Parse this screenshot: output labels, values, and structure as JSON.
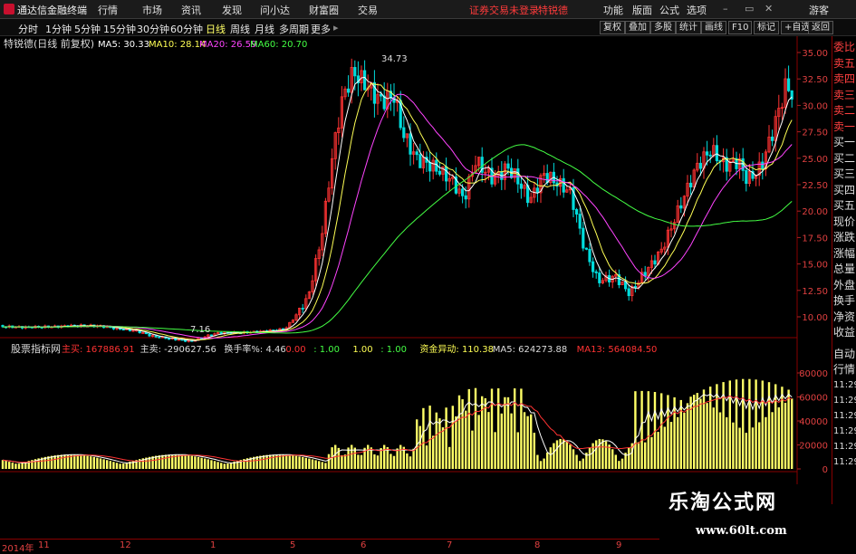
{
  "app": {
    "title": "通达信金融终端",
    "menu": [
      "行情",
      "市场",
      "资讯",
      "发现",
      "问小达",
      "财富圈",
      "交易"
    ],
    "login_status": "证券交易未登录",
    "stock_name": "特锐德",
    "right_menu": [
      "功能",
      "版面",
      "公式",
      "选项"
    ],
    "guest": "游客",
    "logo_icon": "app-logo-icon"
  },
  "toolbar": {
    "periods": [
      "分时",
      "1分钟",
      "5分钟",
      "15分钟",
      "30分钟",
      "60分钟",
      "日线",
      "周线",
      "月线",
      "多周期",
      "更多"
    ],
    "active_period": "日线",
    "right_buttons": [
      "复权",
      "叠加",
      "多股",
      "统计",
      "画线",
      "F10",
      "标记",
      "+自选",
      "返回"
    ]
  },
  "main_chart": {
    "header_title": "特锐德(日线 前复权)",
    "ma_labels": [
      {
        "text": "MA5: 30.33",
        "color": "#ffffff"
      },
      {
        "text": "MA10: 28.14",
        "color": "#ffff55"
      },
      {
        "text": "MA20: 26.59",
        "color": "#ff44ff"
      },
      {
        "text": "MA60: 20.70",
        "color": "#44ff44"
      }
    ],
    "price_axis": [
      "35.00",
      "32.50",
      "30.00",
      "27.50",
      "25.00",
      "22.50",
      "20.00",
      "17.50",
      "15.00",
      "12.50",
      "10.00"
    ],
    "high_label": "34.73",
    "low_label": "7.16",
    "up_color": "#ff3333",
    "down_color": "#00dddd"
  },
  "sub_chart": {
    "indicator_title": "股票指标网",
    "fields": [
      {
        "text": "主买: 167886.91",
        "color": "#ff3333"
      },
      {
        "text": "主卖: -290627.56",
        "color": "#dddddd"
      },
      {
        "text": "换手率%: 4.46",
        "color": "#dddddd"
      },
      {
        "text": "0.00",
        "color": "#ff3333"
      },
      {
        "text": ": 1.00",
        "color": "#44ff44"
      },
      {
        "text": "1.00",
        "color": "#ffff55"
      },
      {
        "text": ": 1.00",
        "color": "#44ff44"
      },
      {
        "text": "资金异动: 110.38",
        "color": "#ffff55"
      },
      {
        "text": "MA5: 624273.88",
        "color": "#dddddd"
      },
      {
        "text": "MA13: 564084.50",
        "color": "#ff3333"
      }
    ],
    "axis": [
      "80000",
      "60000",
      "40000",
      "20000",
      "0"
    ],
    "bar_color": "#ffff66"
  },
  "side_panel": {
    "top": [
      "委比",
      "卖五",
      "卖四",
      "卖三",
      "卖二",
      "卖一",
      "买一",
      "买二",
      "买三",
      "买四",
      "买五",
      "现价",
      "涨跌",
      "涨幅",
      "总量",
      "外盘",
      "换手",
      "净资",
      "收益"
    ],
    "bottom": [
      "自动",
      "行情",
      "11:29",
      "11:29",
      "11:29",
      "11:29",
      "11:29",
      "11:29"
    ]
  },
  "date_axis": [
    "2014年",
    "11",
    "12",
    "1",
    "5",
    "6",
    "7",
    "8",
    "9"
  ],
  "watermark": {
    "title": "乐淘公式网",
    "url": "www.60lt.com"
  }
}
